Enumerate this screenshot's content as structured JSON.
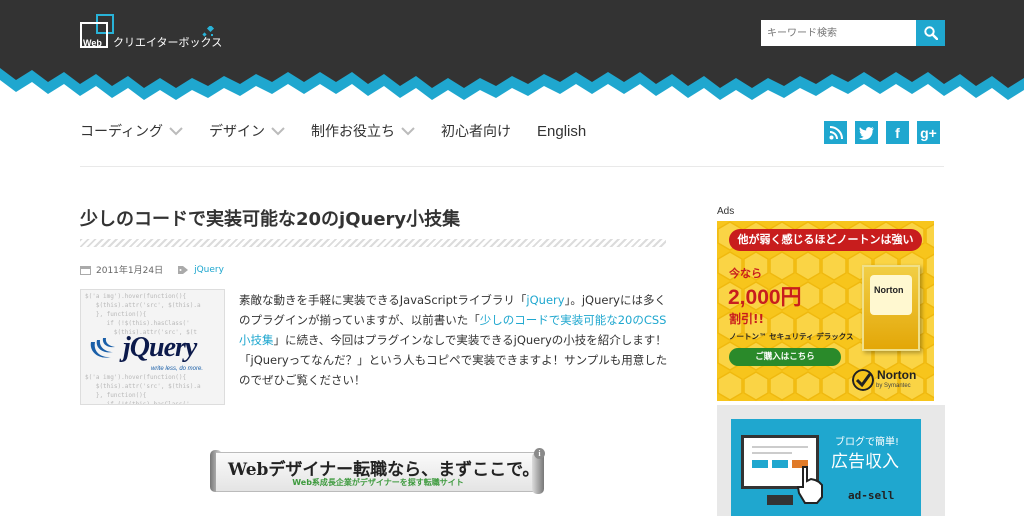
{
  "header": {
    "logo_web": "Web",
    "logo_text": "クリエイターボックス",
    "search": {
      "placeholder": "キーワード検索"
    }
  },
  "nav": {
    "items": [
      {
        "label": "コーディング",
        "has_dropdown": true
      },
      {
        "label": "デザイン",
        "has_dropdown": true
      },
      {
        "label": "制作お役立ち",
        "has_dropdown": true
      },
      {
        "label": "初心者向け",
        "has_dropdown": false
      },
      {
        "label": "English",
        "has_dropdown": false
      }
    ],
    "social": [
      {
        "icon": "rss-icon",
        "glyph": ""
      },
      {
        "icon": "twitter-icon",
        "glyph": ""
      },
      {
        "icon": "facebook-icon",
        "glyph": "f"
      },
      {
        "icon": "google-plus-icon",
        "glyph": "g+"
      }
    ]
  },
  "article": {
    "title": "少しのコードで実装可能な20のjQuery小技集",
    "date": "2011年1月24日",
    "category": "jQuery",
    "thumbnail": {
      "logo": "jQuery",
      "tagline": "write less, do more.",
      "code_lines": [
        "$('a img').hover(function(){",
        "   $(this).attr('src', $(this).a",
        "   }, function(){",
        "      if (!$(this).hasClass('",
        "        $(this).attr('src', $(t",
        "",
        "",
        "",
        "",
        "$('a img').hover(function(){",
        "   $(this).attr('src', $(this).a",
        "   }, function(){",
        "      if (!$(this).hasClass('",
        "        $(this).attr('src', $(t"
      ]
    },
    "excerpt": {
      "p1": "素敵な動きを手軽に実装できるJavaScriptライブラリ「",
      "link1": "jQuery",
      "p2": "」。jQueryには多くのプラグインが揃っていますが、以前書いた「",
      "link2": "少しのコードで実装可能な20のCSS小技集",
      "p3": "」に続き、今回はプラグインなしで実装できるjQueryの小技を紹介します！「jQueryってなんだ？」という人もコピペで実装できますよ！サンプルも用意したのでぜひご覧ください！"
    },
    "banner": {
      "main": "Webデザイナー転職なら、まずここで。",
      "sub": "Web系成長企業がデザイナーを探す転職サイト",
      "info": "i"
    }
  },
  "sidebar": {
    "ads_label": "Ads",
    "norton": {
      "top": "他が弱く感じるほどノートンは強い",
      "now": "今なら",
      "price": "2,000円",
      "off": "割引!!",
      "product": "ノートン™ セキュリティ デラックス",
      "buy": "ご購入はこちら",
      "box_label": "Norton",
      "brand": "Norton",
      "symantec": "by Symantec"
    },
    "adsell": {
      "t1": "ブログで簡単!",
      "t2": "広告収入",
      "t3": "ad-sell"
    }
  },
  "colors": {
    "header_bg": "#333333",
    "accent": "#1fa7cf",
    "norton_yellow": "#f7c51c",
    "norton_red": "#c81d1d"
  }
}
